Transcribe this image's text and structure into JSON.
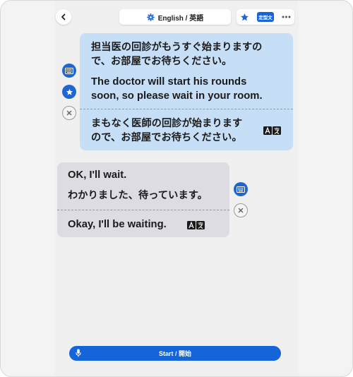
{
  "header": {
    "back_icon": "chevron-left-icon",
    "language_label": "English / 英語",
    "settings_icon": "gear-icon",
    "favorite_icon": "star-icon",
    "phrasebook_label": "定型文",
    "more_icon": "ellipsis-icon"
  },
  "conversation": {
    "message1": {
      "original_line1": "担当医の回診がもうすぐ始まりますの",
      "original_line2": "で、お部屋でお待ちください。",
      "translation_line1": "The doctor will start his rounds",
      "translation_line2": "soon, so please wait in your room.",
      "back_translation_line1": "まもなく医師の回診が始まります",
      "back_translation_line2": "ので、お部屋でお待ちください。",
      "back_translation_icon": "translate-icon",
      "actions": [
        "keyboard-icon",
        "star-icon",
        "close-icon"
      ]
    },
    "message2": {
      "original": "OK, I'll wait.",
      "translation": "わかりました、待っています。",
      "back_translation": "Okay, I'll be waiting.",
      "back_translation_icon": "translate-icon",
      "actions": [
        "keyboard-icon",
        "close-icon"
      ]
    }
  },
  "footer": {
    "start_label": "Start / 開始",
    "mic_icon": "microphone-icon"
  },
  "colors": {
    "accent": "#1565d8",
    "bubble_staff": "#c6dff6",
    "bubble_patient": "#dcdce2"
  }
}
